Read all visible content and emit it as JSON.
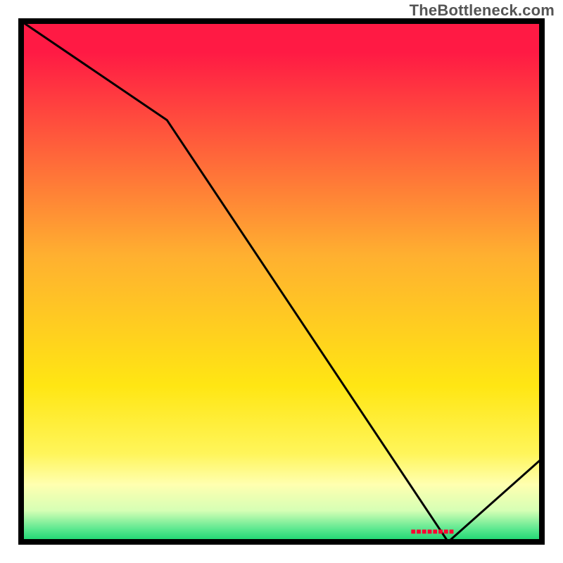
{
  "watermark": "TheBottleneck.com",
  "chart_data": {
    "type": "line",
    "title": "",
    "xlabel": "",
    "ylabel": "",
    "xlim": [
      0,
      100
    ],
    "ylim": [
      0,
      100
    ],
    "x": [
      0,
      28,
      82,
      100
    ],
    "values": [
      100,
      81,
      0,
      16
    ],
    "marker": {
      "x": 79,
      "label": "■■■■■■■■"
    },
    "background_gradient": {
      "stops": [
        {
          "offset": 0.0,
          "color": "#ff1a44"
        },
        {
          "offset": 0.06,
          "color": "#ff1a44"
        },
        {
          "offset": 0.45,
          "color": "#ffb030"
        },
        {
          "offset": 0.7,
          "color": "#ffe613"
        },
        {
          "offset": 0.83,
          "color": "#fff55a"
        },
        {
          "offset": 0.89,
          "color": "#ffffb0"
        },
        {
          "offset": 0.94,
          "color": "#d6ffb5"
        },
        {
          "offset": 0.975,
          "color": "#5de890"
        },
        {
          "offset": 1.0,
          "color": "#14d46e"
        }
      ]
    },
    "border_color": "#000000",
    "line_color": "#000000"
  }
}
